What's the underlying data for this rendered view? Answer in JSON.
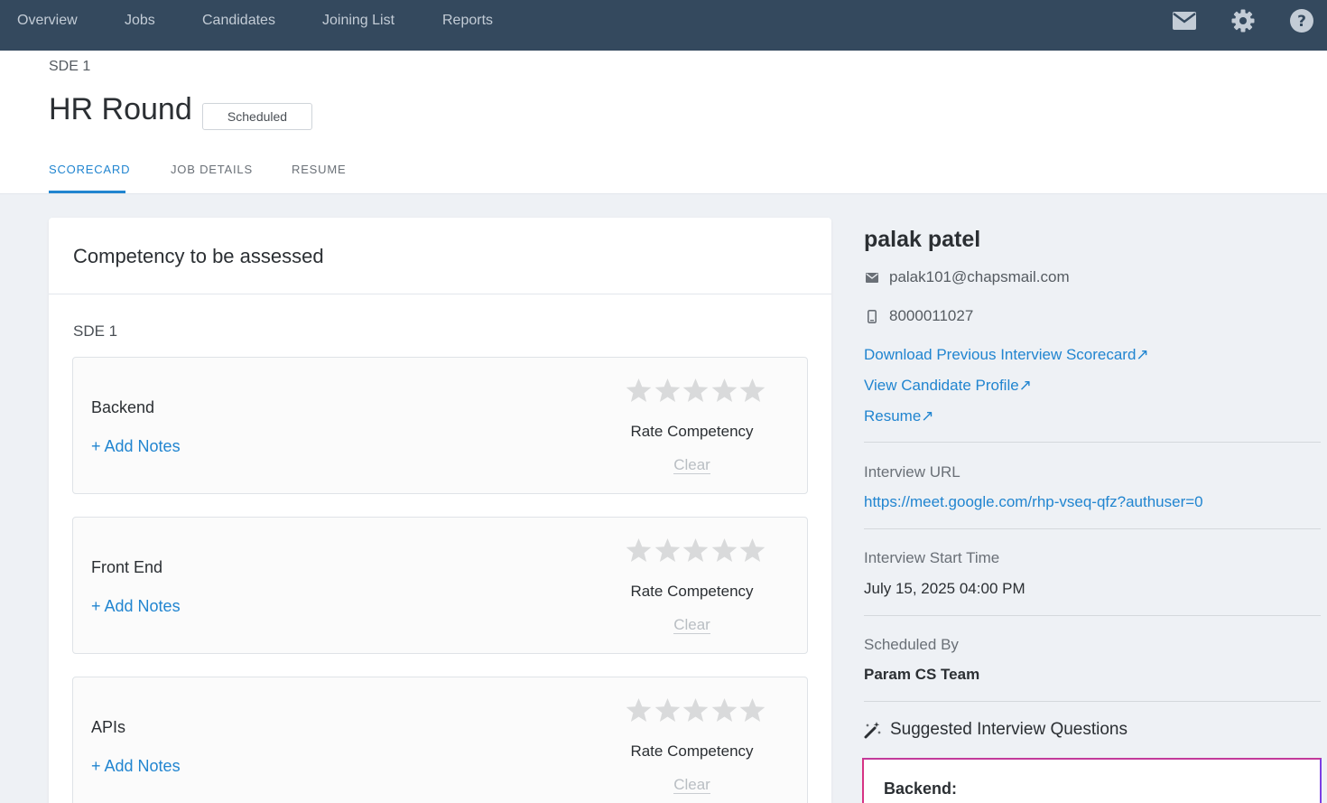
{
  "nav": {
    "items": [
      "Overview",
      "Jobs",
      "Candidates",
      "Joining List",
      "Reports"
    ],
    "icons": [
      "mail-icon",
      "gear-icon",
      "help-icon"
    ]
  },
  "header": {
    "breadcrumb": "SDE 1",
    "title": "HR Round",
    "status": "Scheduled",
    "tabs": [
      "SCORECARD",
      "JOB DETAILS",
      "RESUME"
    ],
    "active_tab": "SCORECARD"
  },
  "scorecard": {
    "title": "Competency to be assessed",
    "section": "SDE 1",
    "competencies": [
      {
        "name": "Backend",
        "add_notes": "+ Add Notes",
        "rate_label": "Rate Competency",
        "clear_label": "Clear",
        "rating": 0
      },
      {
        "name": "Front End",
        "add_notes": "+ Add Notes",
        "rate_label": "Rate Competency",
        "clear_label": "Clear",
        "rating": 0
      },
      {
        "name": "APIs",
        "add_notes": "+ Add Notes",
        "rate_label": "Rate Competency",
        "clear_label": "Clear",
        "rating": 0
      }
    ]
  },
  "candidate": {
    "name": "palak patel",
    "email": "palak101@chapsmail.com",
    "phone": "8000011027",
    "links": [
      "Download Previous Interview Scorecard↗",
      "View Candidate Profile↗",
      "Resume↗"
    ],
    "interview_url_label": "Interview URL",
    "interview_url": "https://meet.google.com/rhp-vseq-qfz?authuser=0",
    "start_time_label": "Interview Start Time",
    "start_time": "July 15, 2025 04:00 PM",
    "scheduled_by_label": "Scheduled By",
    "scheduled_by": "Param CS Team",
    "suggested_title": "Suggested Interview Questions",
    "questions_heading": "Backend:"
  },
  "colors": {
    "nav_bg": "#34495e",
    "accent": "#2185d0",
    "star_empty": "#d9dadb",
    "page_bg": "#eef1f5"
  }
}
